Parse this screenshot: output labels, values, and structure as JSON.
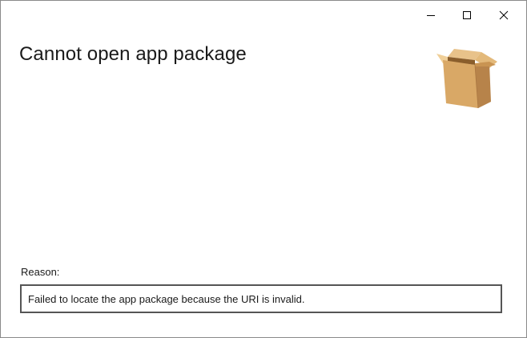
{
  "window": {
    "controls": {
      "minimize": "minimize-icon",
      "maximize": "maximize-icon",
      "close": "close-icon"
    }
  },
  "dialog": {
    "title": "Cannot open app package",
    "icon": "package-box-icon",
    "reason_label": "Reason:",
    "reason_text": "Failed to locate the app package because the URI is invalid."
  },
  "colors": {
    "background": "#ffffff",
    "text": "#1a1a1a",
    "reason_border": "#555555",
    "box_front": "#d9a866",
    "box_side": "#b7834a"
  }
}
